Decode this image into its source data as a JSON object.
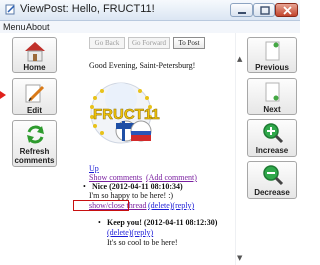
{
  "window": {
    "title": "ViewPost: Hello, FRUCT11!"
  },
  "menu": {
    "items": [
      "Menu",
      "About"
    ]
  },
  "left_toolbar": {
    "home": "Home",
    "edit": "Edit",
    "refresh_line1": "Refresh",
    "refresh_line2": "comments"
  },
  "right_toolbar": {
    "previous": "Previous",
    "next": "Next",
    "increase": "Increase",
    "decrease": "Decrease"
  },
  "nav": {
    "back": "Go Back",
    "forward": "Go Forward",
    "to_post": "To Post"
  },
  "post": {
    "greeting": "Good Evening, Saint-Petersburg!",
    "logo_text": "FRUCT11"
  },
  "comments": {
    "up": "Up",
    "show_comments": "Show comments",
    "add_comment": "(Add comment)",
    "c1_title": "Nice (2012-04-11 08:10:34)",
    "c1_body": "I'm so happy to be here! :)",
    "c1_toggle": "show/close thread",
    "c1_actions": "(delete)(reply)",
    "c2_title": "Keep you! (2012-04-11 08:12:30)",
    "c2_actions": "(delete)(reply)",
    "c2_body": "It's so cool to be here!"
  },
  "colors": {
    "link": "#1a1ad6",
    "visited": "#7a1fa0",
    "highlight": "#c81010",
    "titlebar": "#dbe6f3"
  }
}
